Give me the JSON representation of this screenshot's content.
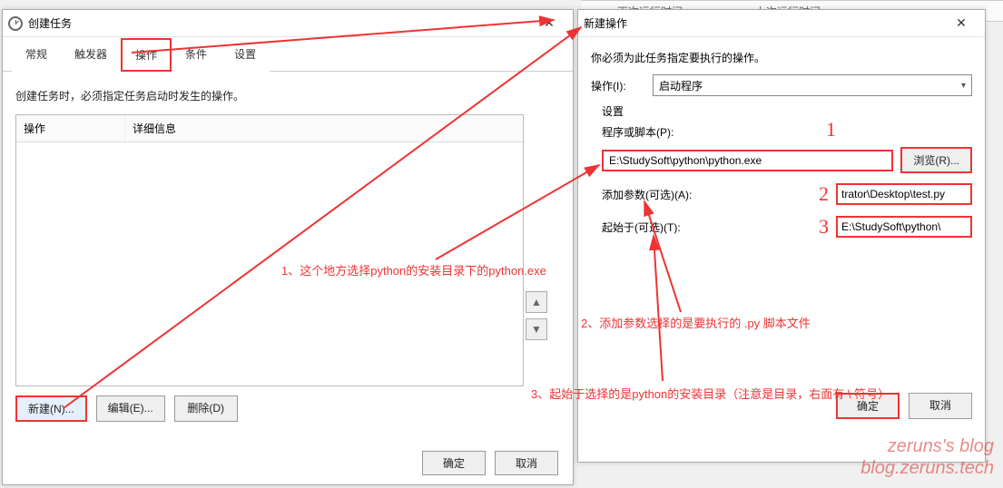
{
  "backdrop": {
    "col1": "下次运行时间",
    "col2": "上次运行时间"
  },
  "leftDialog": {
    "title": "创建任务",
    "tabs": [
      "常规",
      "触发器",
      "操作",
      "条件",
      "设置"
    ],
    "activeTab": 2,
    "desc": "创建任务时，必须指定任务启动时发生的操作。",
    "columns": [
      "操作",
      "详细信息"
    ],
    "upBtn": "▲",
    "downBtn": "▼",
    "newBtn": "新建(N)...",
    "editBtn": "编辑(E)...",
    "deleteBtn": "删除(D)",
    "okBtn": "确定",
    "cancelBtn": "取消",
    "closeX": "✕"
  },
  "rightDialog": {
    "title": "新建操作",
    "desc": "你必须为此任务指定要执行的操作。",
    "actionLabel": "操作(I):",
    "actionSelected": "启动程序",
    "settingsLabel": "设置",
    "programLabel": "程序或脚本(P):",
    "programValue": "E:\\StudySoft\\python\\python.exe",
    "browseBtn": "浏览(R)...",
    "argsLabel": "添加参数(可选)(A):",
    "argsValue": "trator\\Desktop\\test.py",
    "startInLabel": "起始于(可选)(T):",
    "startInValue": "E:\\StudySoft\\python\\",
    "okBtn": "确定",
    "cancelBtn": "取消",
    "closeX": "✕"
  },
  "annotations": {
    "a1": "1、这个地方选择python的安装目录下的python.exe",
    "a2": "2、添加参数选择的是要执行的 .py 脚本文件",
    "a3": "3、起始于选择的是python的安装目录（注意是目录，右面有 \\ 符号）",
    "sq1": "1",
    "sq2": "2",
    "sq3": "3"
  },
  "watermark": {
    "w1": "zeruns's blog",
    "w2": "blog.zeruns.tech"
  }
}
